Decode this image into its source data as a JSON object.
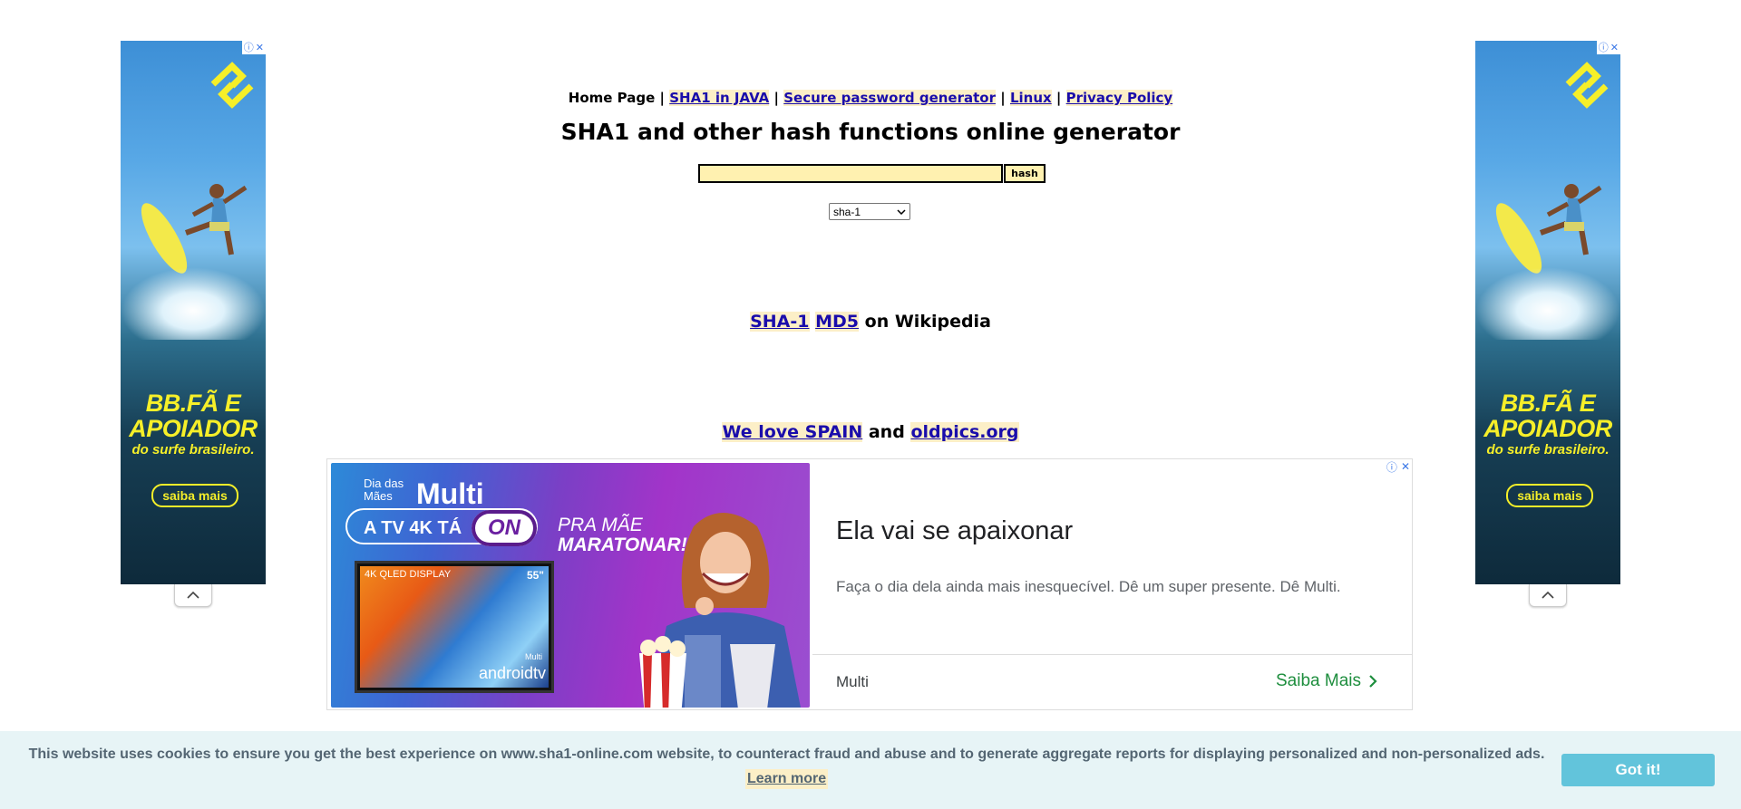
{
  "nav": {
    "home": "Home Page",
    "sep": "|",
    "links": [
      "SHA1 in JAVA",
      "Secure password generator",
      "Linux",
      "Privacy Policy"
    ]
  },
  "title": "SHA1 and other hash functions online generator",
  "form": {
    "input_value": "",
    "button_label": "hash",
    "algorithm_selected": "sha-1"
  },
  "wiki": {
    "link1": "SHA-1",
    "link2": "MD5",
    "suffix": "on Wikipedia"
  },
  "footer_links": {
    "link1": "We love SPAIN",
    "and": "and",
    "link2": "oldpics.org"
  },
  "side_ad": {
    "line1": "BB.FÃ E",
    "line2": "APOIADOR",
    "line3": "do surfe brasileiro.",
    "cta": "saiba mais",
    "colors": {
      "text": "#f6ef29"
    }
  },
  "banner_ad": {
    "image": {
      "small_text": "Dia das Mães",
      "brand": "Multi",
      "pill": "A TV 4K TÁ",
      "on": "ON",
      "slogan1": "PRA MÃE",
      "slogan2": "MARATONAR!",
      "tv_label": "4K QLED DISPLAY",
      "tv_size": "55\"",
      "tv_brand": "Multi",
      "tv_os": "androidtv"
    },
    "headline": "Ela vai se apaixonar",
    "description": "Faça o dia dela ainda mais inesquecível. Dê um super presente. Dê Multi.",
    "advertiser": "Multi",
    "cta": "Saiba Mais"
  },
  "cookie": {
    "message": "This website uses cookies to ensure you get the best experience on www.sha1-online.com website, to counteract fraud and abuse and to generate aggregate reports for displaying personalized and non-personalized ads.",
    "learn_more": "Learn more",
    "button": "Got it!"
  }
}
